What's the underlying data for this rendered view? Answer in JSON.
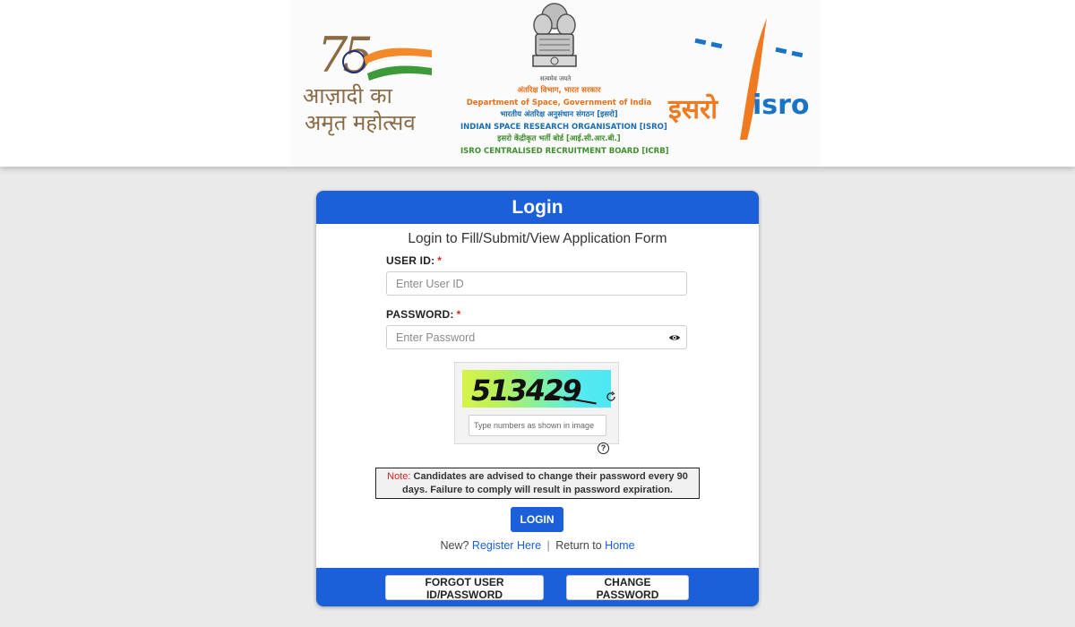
{
  "header": {
    "azadi_logo": {
      "number": "75",
      "line1": "आज़ादी का",
      "line2": "अमृत महोत्सव"
    },
    "emblem_motto": "सत्यमेव जयते",
    "org": {
      "line1": "अंतरिक्ष विभाग, भारत सरकार",
      "line2": "Department of Space, Government of India",
      "line3": "भारतीय अंतरिक्ष अनुसंधान संगठन [इसरो]",
      "line4": "INDIAN SPACE RESEARCH ORGANISATION [ISRO]",
      "line5": "इसरो केंद्रीकृत भर्ती बोर्ड [आई.सी.आर.बी.]",
      "line6": "ISRO CENTRALISED RECRUITMENT BOARD [ICRB]"
    },
    "isro_logo": {
      "hindi": "इसरो",
      "english": "isro"
    }
  },
  "login": {
    "title": "Login",
    "subtitle": "Login to Fill/Submit/View Application Form",
    "user_id_label": "USER ID:",
    "user_id_placeholder": "Enter User ID",
    "password_label": "PASSWORD:",
    "password_placeholder": "Enter Password",
    "required_mark": "*",
    "captcha_value": "513429",
    "captcha_placeholder": "Type numbers as shown in image",
    "help_symbol": "?",
    "note_label": "Note:",
    "note_text": "Candidates are advised to change their password every 90 days. Failure to comply will result in password expiration.",
    "login_button": "LOGIN",
    "new_text": "New?",
    "register_link": "Register Here",
    "separator": "|",
    "return_text": "Return to",
    "home_link": "Home",
    "forgot_button": "FORGOT USER ID/PASSWORD",
    "change_password_button": "CHANGE PASSWORD"
  },
  "colors": {
    "primary": "#1b5fd9",
    "saffron": "#f07a1f",
    "required": "#e02020"
  }
}
